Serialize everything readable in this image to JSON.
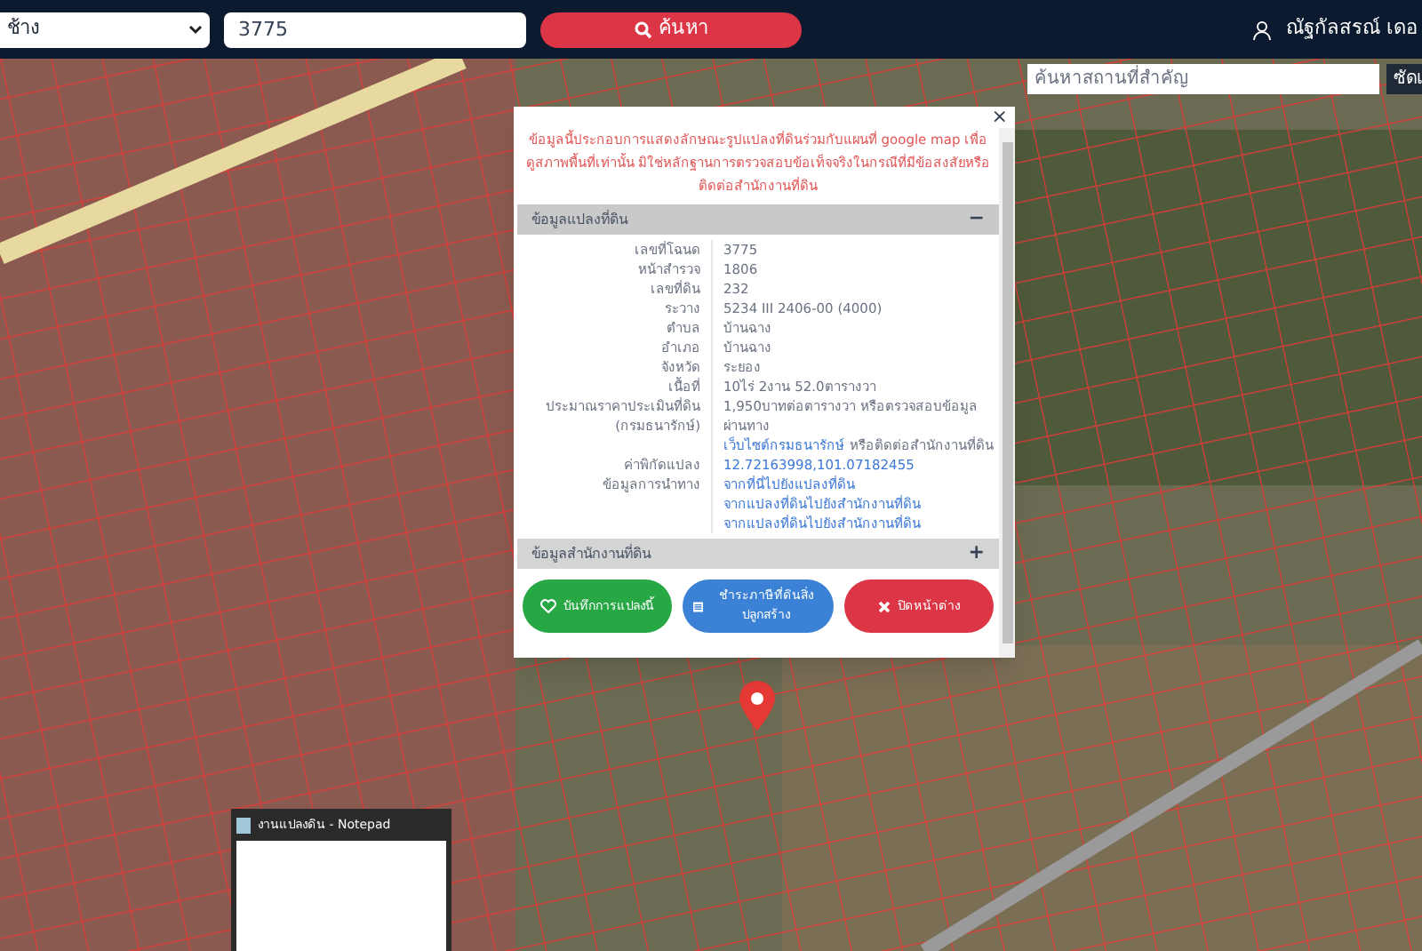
{
  "top_bar": {
    "district_select": "ช้าง",
    "parcel_input": "3775",
    "search_button": "ค้นหา",
    "user_name": "ณัฐกัลสรณ์ เดอ"
  },
  "map": {
    "place_search": {
      "placeholder": "ค้นหาสถานที่สำคัญ"
    },
    "side_button": "ซัดเ"
  },
  "popup": {
    "close": "×",
    "notice": "ข้อมูลนี้ประกอบการแสดงลักษณะรูปแปลงที่ดินร่วมกับแผนที่ google map เพื่อดูสภาพพื้นที่เท่านั้น มิใช่หลักฐานการตรวจสอบข้อเท็จจริงในกรณีที่มีข้อสงสัยหรือติดต่อสำนักงานที่ดิน",
    "sections": [
      {
        "title": "ข้อมูลแปลงที่ดิน",
        "expanded": true,
        "toggle": "−",
        "rows": [
          {
            "label": "เลขที่โฉนด",
            "parts": [
              {
                "kind": "text",
                "text": "3775"
              }
            ]
          },
          {
            "label": "หน้าสำรวจ",
            "parts": [
              {
                "kind": "text",
                "text": "1806"
              }
            ]
          },
          {
            "label": "เลขที่ดิน",
            "parts": [
              {
                "kind": "text",
                "text": "232"
              }
            ]
          },
          {
            "label": "ระวาง",
            "parts": [
              {
                "kind": "text",
                "text": "5234 III 2406-00 (4000)"
              }
            ]
          },
          {
            "label": "ตำบล",
            "parts": [
              {
                "kind": "text",
                "text": "บ้านฉาง"
              }
            ]
          },
          {
            "label": "อำเภอ",
            "parts": [
              {
                "kind": "text",
                "text": "บ้านฉาง"
              }
            ]
          },
          {
            "label": "จังหวัด",
            "parts": [
              {
                "kind": "text",
                "text": "ระยอง"
              }
            ]
          },
          {
            "label": "เนื้อที่",
            "parts": [
              {
                "kind": "text",
                "text": "10ไร่ 2งาน 52.0ตารางวา"
              }
            ]
          },
          {
            "label": "ประมาณราคาประเมินที่ดิน (กรมธนารักษ์)",
            "parts": [
              {
                "kind": "text",
                "text": "1,950บาทต่อตารางวา หรือตรวจสอบข้อมูลผ่านทาง"
              },
              {
                "kind": "link",
                "text": "เว็บไซต์กรมธนารักษ์"
              },
              {
                "kind": "text",
                "text": "หรือติดต่อสำนักงานที่ดิน"
              }
            ]
          },
          {
            "label": "ค่าพิกัดแปลง",
            "parts": [
              {
                "kind": "link",
                "text": "12.72163998,101.07182455"
              }
            ]
          },
          {
            "label": "ข้อมูลการนำทาง",
            "parts": [
              {
                "kind": "link",
                "text": "จากที่นี่ไปยังแปลงที่ดิน"
              },
              {
                "kind": "link",
                "text": "จากแปลงที่ดินไปยังสำนักงานที่ดิน"
              },
              {
                "kind": "break"
              },
              {
                "kind": "link",
                "text": "จากแปลงที่ดินไปยังสำนักงานที่ดิน"
              }
            ]
          }
        ]
      },
      {
        "title": "ข้อมูลสำนักงานที่ดิน",
        "expanded": false,
        "toggle": "+"
      }
    ],
    "buttons": [
      {
        "kind": "save",
        "label": "บันทึกการแปลงนี้"
      },
      {
        "kind": "tax",
        "label": "ชำระภาษีที่ดินสิ่งปลูกสร้าง"
      },
      {
        "kind": "close",
        "label": "ปิดหน้าต่าง"
      }
    ]
  },
  "notepad": {
    "title": "งานแปลงดิน - Notepad"
  }
}
